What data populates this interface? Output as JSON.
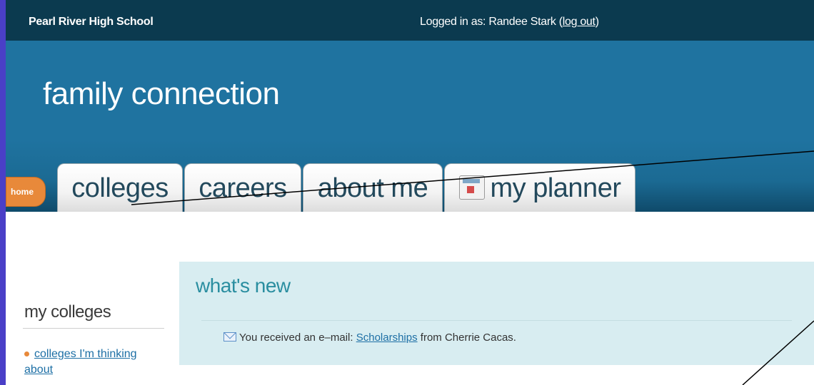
{
  "topbar": {
    "school": "Pearl River High School",
    "login_prefix": "Logged in as: Randee Stark (",
    "logout": "log out",
    "login_suffix": ")"
  },
  "brand": "family connection",
  "tabs": {
    "home": "home",
    "colleges": "colleges",
    "careers": "careers",
    "about_me": "about me",
    "planner": "my planner"
  },
  "sidebar": {
    "title": "my colleges",
    "items": [
      {
        "label": "colleges I'm thinking about"
      }
    ]
  },
  "news": {
    "title": "what's new",
    "message_prefix": "You received an e–mail: ",
    "message_link": "Scholarships",
    "message_suffix": " from Cherrie Cacas."
  },
  "colors": {
    "topbar": "#0b3a4f",
    "banner": "#1f73a0",
    "home_pill": "#e8893a",
    "news_bg": "#d8edf1",
    "link": "#1d6fa5",
    "outer_bg": "#4a3fc7"
  }
}
